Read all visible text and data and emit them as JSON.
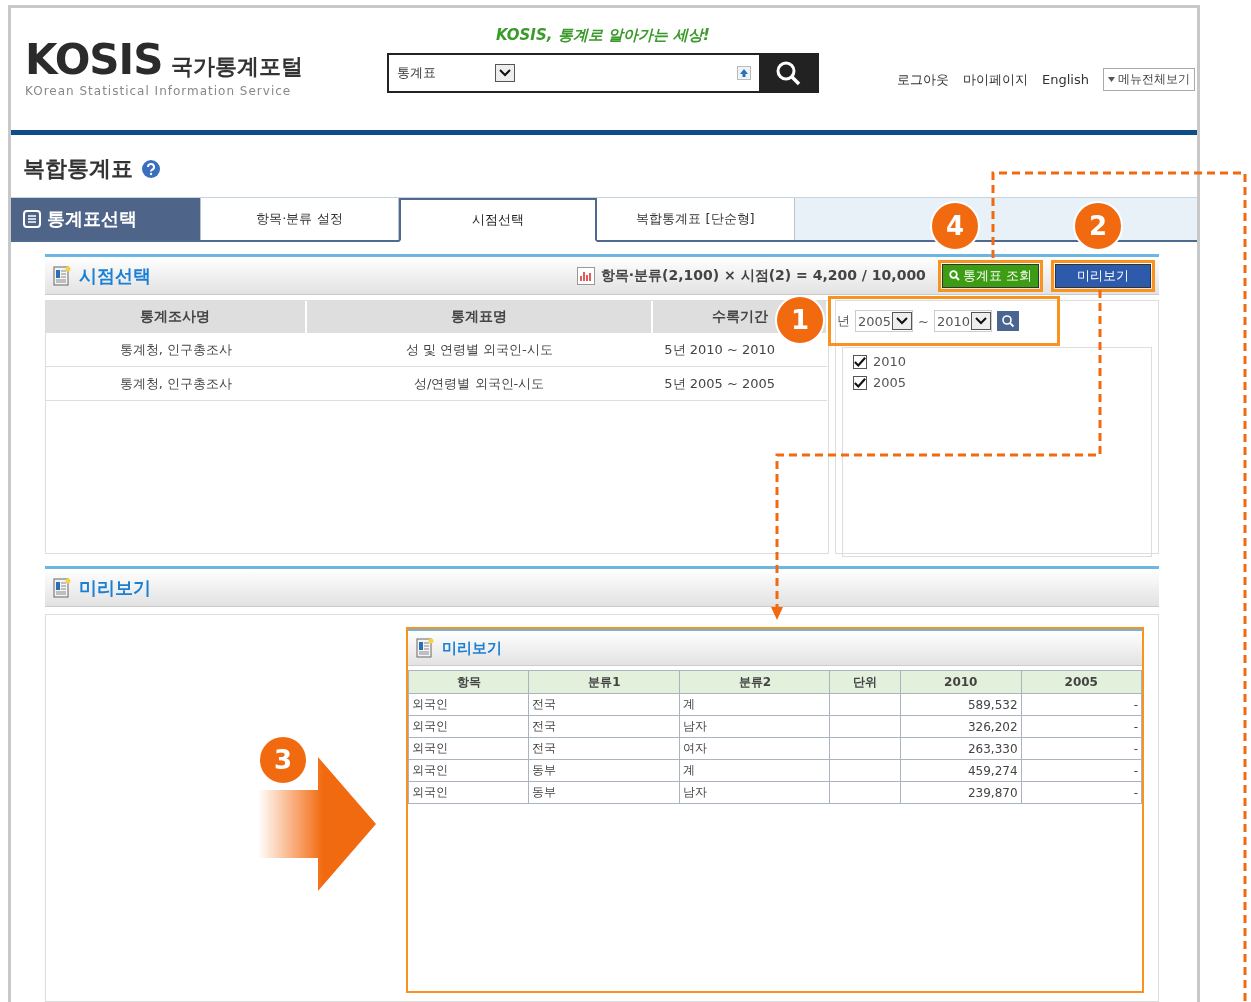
{
  "header": {
    "slogan": "KOSIS, 통계로 알아가는 세상!",
    "logo": "KOSIS",
    "logo_subtitle": "국가통계포털",
    "logo_tagline": "KOrean Statistical Information Service",
    "search": {
      "category": "통계표"
    },
    "links": [
      "로그아웃",
      "마이페이지",
      "English"
    ],
    "menu_button": "메뉴전체보기"
  },
  "page_title": "복합통계표",
  "tabs": [
    {
      "label": "통계표선택",
      "kind": "heading",
      "selected": false
    },
    {
      "label": "항목·분류 설정",
      "kind": "tab",
      "selected": false
    },
    {
      "label": "시점선택",
      "kind": "tab",
      "selected": true
    },
    {
      "label": "복합통계표 [단순형]",
      "kind": "tab",
      "selected": false
    }
  ],
  "time_section": {
    "title": "시점선택",
    "summary": "항목·분류(2,100) × 시점(2) = 4,200 / 10,000",
    "buttons": [
      {
        "label": "통계표 조회",
        "kind": "lookup"
      },
      {
        "label": "미리보기",
        "kind": "preview"
      }
    ],
    "table": {
      "columns": [
        "통계조사명",
        "통계표명",
        "수록기간"
      ],
      "rows": [
        [
          "통계청, 인구총조사",
          "성 및 연령별 외국인-시도",
          "5년 2010 ~ 2010"
        ],
        [
          "통계청, 인구총조사",
          "성/연령별 외국인-시도",
          "5년 2005 ~ 2005"
        ]
      ]
    },
    "year_filter": {
      "label": "년",
      "from": "2005",
      "separator": "~",
      "to": "2010"
    },
    "years": [
      {
        "label": "2010",
        "checked": true
      },
      {
        "label": "2005",
        "checked": true
      }
    ]
  },
  "preview_section": {
    "title": "미리보기",
    "inner_title": "미리보기",
    "table": {
      "columns": [
        "항목",
        "분류1",
        "분류2",
        "단위",
        "2010",
        "2005"
      ],
      "rows": [
        [
          "외국인",
          "전국",
          "계",
          "",
          "589,532",
          "-"
        ],
        [
          "외국인",
          "전국",
          "남자",
          "",
          "326,202",
          "-"
        ],
        [
          "외국인",
          "전국",
          "여자",
          "",
          "263,330",
          "-"
        ],
        [
          "외국인",
          "동부",
          "계",
          "",
          "459,274",
          "-"
        ],
        [
          "외국인",
          "동부",
          "남자",
          "",
          "239,870",
          "-"
        ]
      ]
    }
  },
  "annotations": [
    {
      "number": "1"
    },
    {
      "number": "2"
    },
    {
      "number": "3"
    },
    {
      "number": "4"
    }
  ]
}
